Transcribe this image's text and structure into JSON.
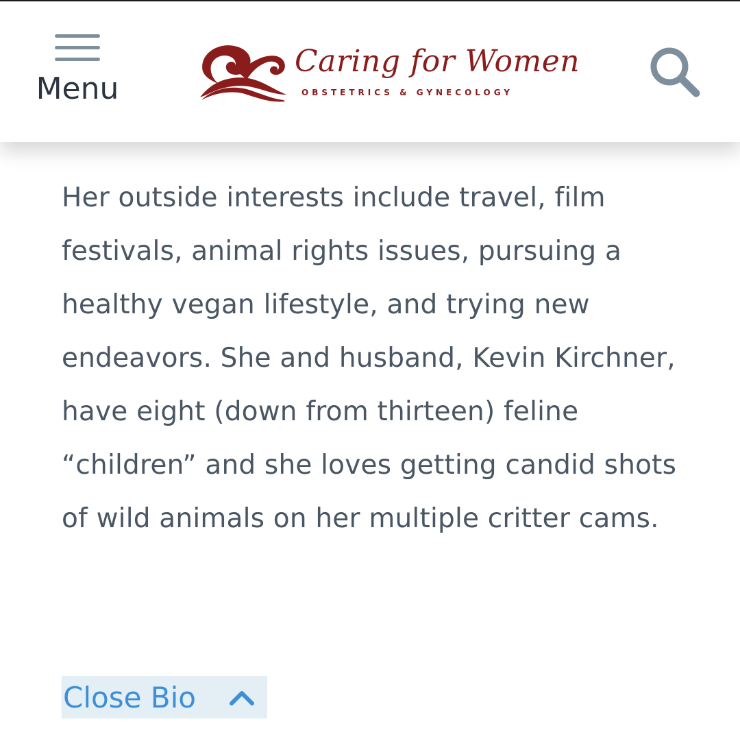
{
  "header": {
    "menu_label": "Menu",
    "menu_icon": "hamburger-icon",
    "search_icon": "search-icon",
    "logo": {
      "name": "Caring for Women",
      "tagline": "OBSTETRICS & GYNECOLOGY",
      "brand_color": "#8a1c1c"
    }
  },
  "bio": {
    "text": "Her outside interests include travel, film festivals, animal rights issues, pursuing a healthy vegan lifestyle, and trying new endeavors. She and husband, Kevin Kirchner, have eight (down from thirteen) feline “children” and she loves getting candid shots of wild animals on her multiple critter cams.",
    "close_label": "Close Bio",
    "close_icon": "chevron-up-icon"
  },
  "colors": {
    "text": "#4a5663",
    "link": "#3d8fd6",
    "link_background": "#e3eef5",
    "icon": "#7d8f9c"
  }
}
